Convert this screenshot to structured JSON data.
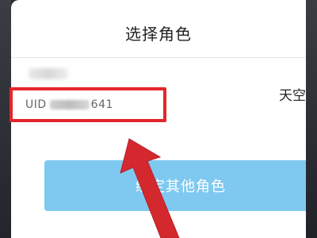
{
  "dialog": {
    "title": "选择角色",
    "role": {
      "uid_prefix": "UID",
      "uid_suffix": "641",
      "server_name": "天空"
    },
    "bind_button_label": "绑定其他角色"
  },
  "colors": {
    "highlight": "#e4262b",
    "button": "#7fc9f1",
    "arrow": "#d4282f"
  },
  "icons": {
    "arrow": "red-pointer-arrow-icon"
  }
}
